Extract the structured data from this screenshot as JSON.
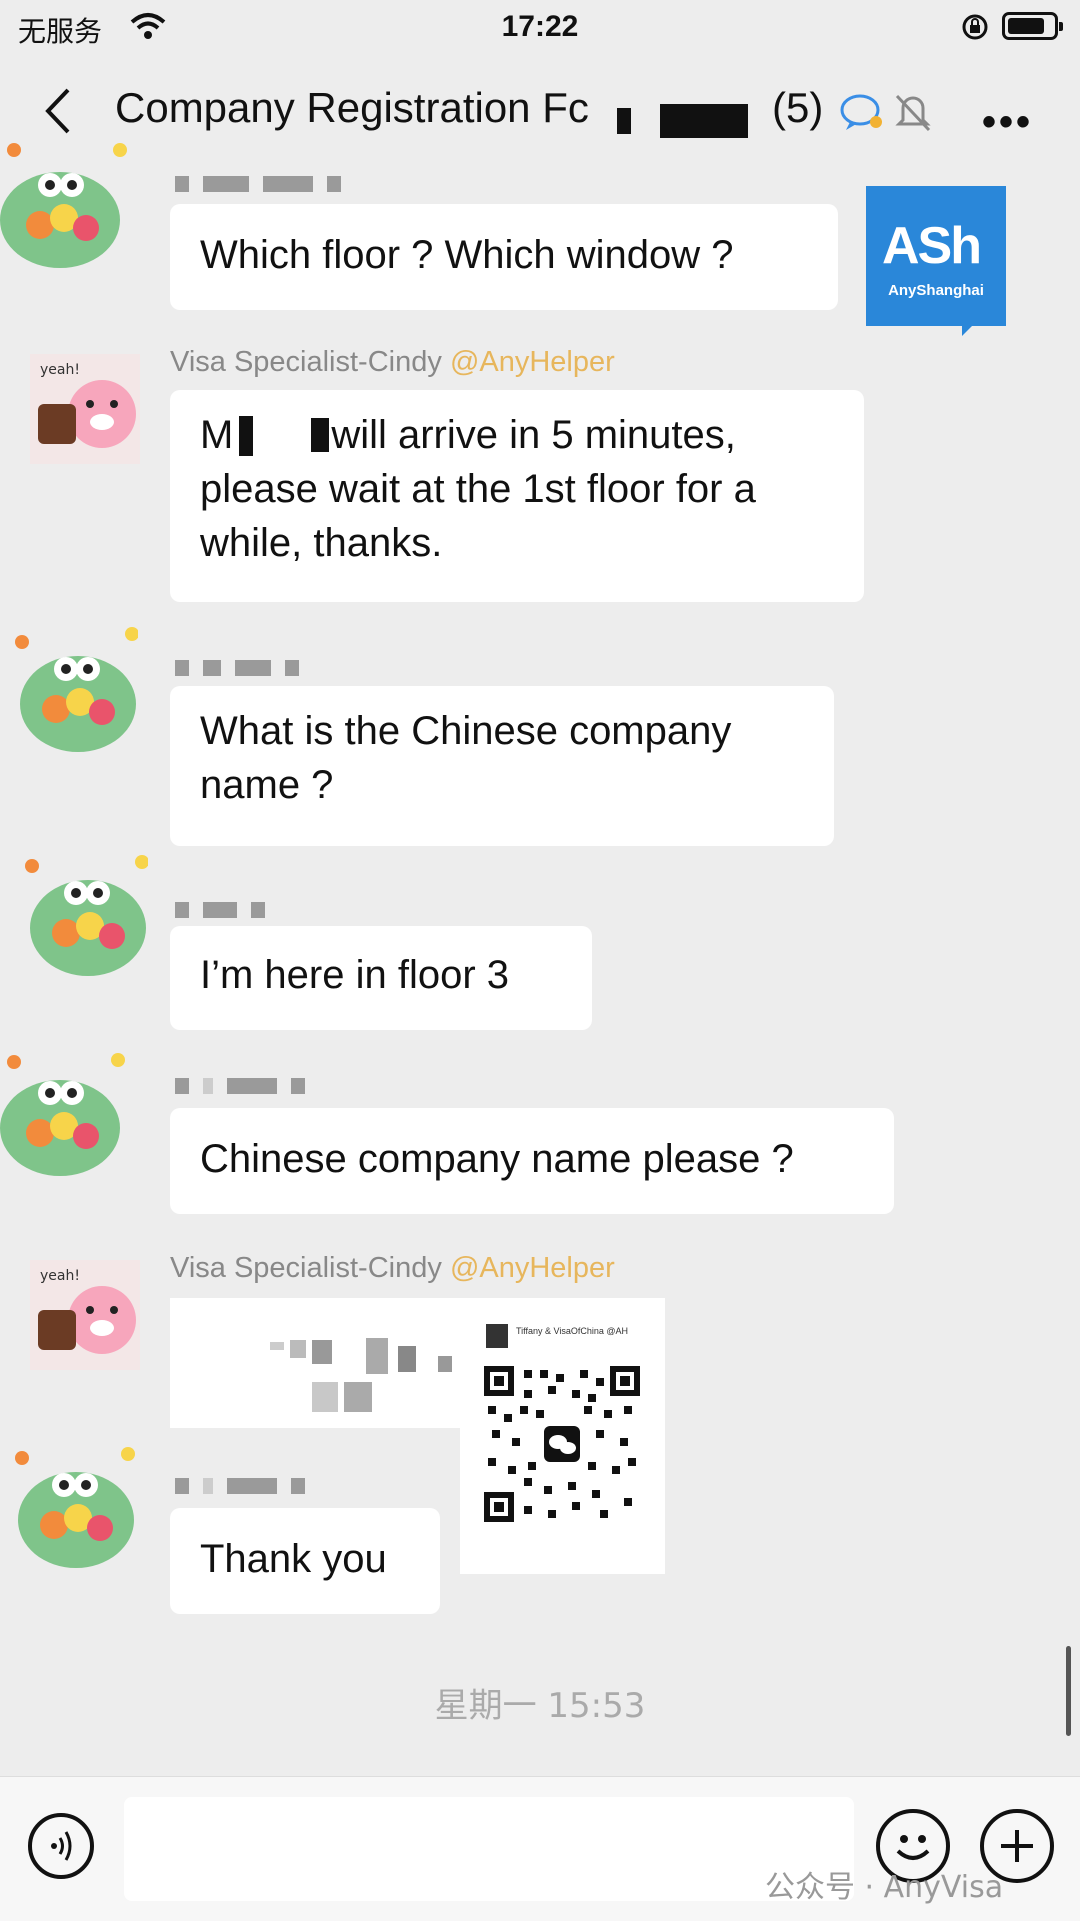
{
  "status_bar": {
    "carrier": "无服务",
    "time": "17:22"
  },
  "header": {
    "title": "Company Registration Fc",
    "member_count": "(5)"
  },
  "messages": [
    {
      "sender": "",
      "text": "Which floor ? Which window ?"
    },
    {
      "sender": "Visa Specialist-Cindy",
      "sender_tag": "@AnyHelper",
      "text_line1": "M",
      "text_rest": "will arrive in 5 minutes,",
      "text_line2": "please wait at the 1st floor for a",
      "text_line3": "while, thanks."
    },
    {
      "sender": "",
      "text_line1": "What is the Chinese company",
      "text_line2": "name ?"
    },
    {
      "sender": "",
      "text": "I’m here in floor 3"
    },
    {
      "sender": "",
      "text": "Chinese company name please ?"
    },
    {
      "sender": "Visa Specialist-Cindy",
      "sender_tag": "@AnyHelper",
      "type": "image"
    },
    {
      "sender": "",
      "text": "Thank you"
    }
  ],
  "ash_logo": {
    "big": "ASh",
    "small": "AnyShanghai"
  },
  "qr_card": {
    "name": "Tiffany & VisaOfChina @AH"
  },
  "timestamp": "星期一 15:53",
  "watermark": "公众号 · AnyVisa",
  "colors": {
    "background": "#ededed",
    "bubble": "#ffffff",
    "at_tag": "#e7b65c",
    "logo_blue": "#2a87d9"
  }
}
